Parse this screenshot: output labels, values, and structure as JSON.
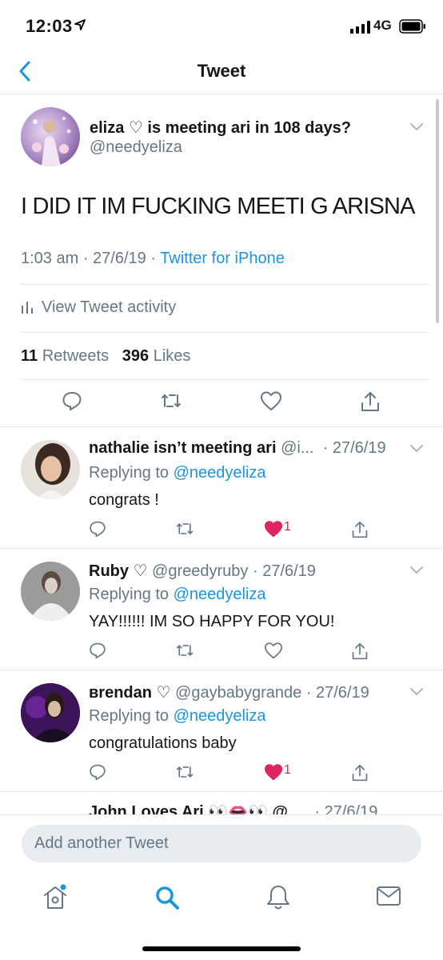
{
  "status_bar": {
    "time": "12:03",
    "network": "4G"
  },
  "nav": {
    "title": "Tweet"
  },
  "main_tweet": {
    "name": "eliza ♡ is meeting ari in 108 days?",
    "handle": "@needyeliza",
    "text": "I DID IT IM FUCKING MEETI G ARISNA",
    "time": "1:03 am · 27/6/19 · ",
    "source": "Twitter for iPhone",
    "activity_label": "View Tweet activity",
    "retweets_count": "11",
    "retweets_label": " Retweets",
    "likes_count": "396",
    "likes_label": " Likes"
  },
  "replies": [
    {
      "name": "nathalie isn’t meeting ari",
      "handle": " @i...",
      "date": " · 27/6/19",
      "replying_prefix": "Replying to ",
      "replying_to": "@needyeliza",
      "text": "congrats !",
      "like_count": "1",
      "liked": true
    },
    {
      "name": "Ruby ♡",
      "handle": " @greedyruby",
      "date": " · 27/6/19",
      "replying_prefix": "Replying to ",
      "replying_to": "@needyeliza",
      "text": "YAY!!!!!!  IM SO HAPPY FOR YOU!",
      "like_count": "",
      "liked": false
    },
    {
      "name": "вrendan ♡",
      "handle": " @gaybabygrande",
      "date": " · 27/6/19",
      "replying_prefix": "Replying to ",
      "replying_to": "@needyeliza",
      "text": "congratulations baby",
      "like_count": "1",
      "liked": true
    }
  ],
  "partial_reply": {
    "name": "John Loves Ari 👀👄👀 @",
    "date": "· 27/6/19"
  },
  "compose": {
    "placeholder": "Add another Tweet"
  },
  "colors": {
    "accent": "#1b95e0",
    "like": "#e0245e",
    "secondary": "#657786"
  },
  "icons": [
    "location-arrow-icon",
    "signal-icon",
    "battery-icon",
    "back-chevron-icon",
    "chevron-down-icon",
    "activity-bars-icon",
    "reply-icon",
    "retweet-icon",
    "like-icon",
    "share-icon",
    "home-icon",
    "search-icon",
    "bell-icon",
    "mail-icon"
  ]
}
